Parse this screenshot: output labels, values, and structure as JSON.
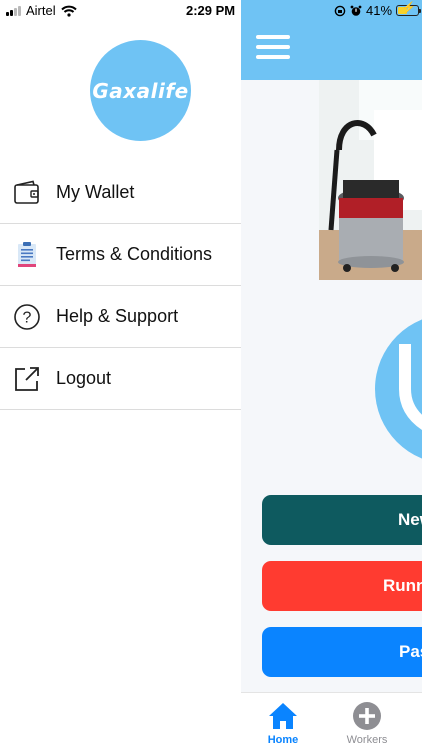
{
  "status_bar": {
    "carrier": "Airtel",
    "time": "2:29 PM",
    "battery_percent": "41%",
    "battery_level": 0.41,
    "icons": [
      "signal-icon",
      "wifi-icon",
      "lock-rotation-icon",
      "alarm-icon",
      "battery-icon"
    ]
  },
  "drawer": {
    "logo_text": "Gaxalife",
    "items": [
      {
        "label": "My Wallet",
        "icon": "wallet-icon"
      },
      {
        "label": "Terms & Conditions",
        "icon": "document-icon"
      },
      {
        "label": "Help & Support",
        "icon": "question-icon"
      },
      {
        "label": "Logout",
        "icon": "external-link-icon"
      }
    ]
  },
  "main": {
    "buttons": [
      {
        "label": "New"
      },
      {
        "label": "Runn"
      },
      {
        "label": "Pas"
      }
    ],
    "tabs": [
      {
        "label": "Home",
        "icon": "home-icon"
      },
      {
        "label": "Workers",
        "icon": "plus-circle-icon"
      }
    ]
  },
  "colors": {
    "brand": "#6fc3f4",
    "new_button": "#0e5a5f",
    "running_button": "#ff3b30",
    "past_button": "#0a84ff",
    "active_tab": "#0a84ff",
    "inactive_tab": "#8e8e93"
  }
}
